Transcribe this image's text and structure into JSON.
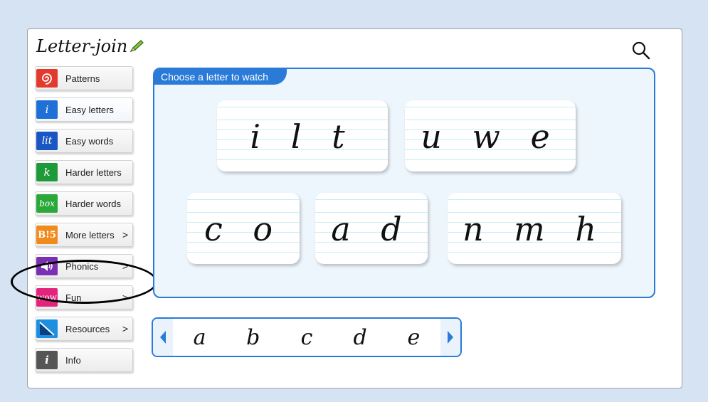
{
  "app": {
    "logo_text": "Letter-join"
  },
  "sidebar": {
    "items": [
      {
        "label": "Patterns",
        "icon": "spiral-icon",
        "glyph": "",
        "color": "#e23b2e",
        "chevron": ""
      },
      {
        "label": "Easy letters",
        "icon": "letter-i-icon",
        "glyph": "i",
        "color": "#1e6fd6",
        "chevron": ""
      },
      {
        "label": "Easy words",
        "icon": "word-lit-icon",
        "glyph": "lit",
        "color": "#1a55c4",
        "chevron": ""
      },
      {
        "label": "Harder letters",
        "icon": "letter-k-icon",
        "glyph": "k",
        "color": "#1f9a3a",
        "chevron": ""
      },
      {
        "label": "Harder words",
        "icon": "word-box-icon",
        "glyph": "box",
        "color": "#2aa83a",
        "chevron": ""
      },
      {
        "label": "More letters",
        "icon": "b-exclaim-5-icon",
        "glyph": "B!5",
        "color": "#f08a1c",
        "chevron": ">"
      },
      {
        "label": "Phonics",
        "icon": "speaker-icon",
        "glyph": "",
        "color": "#7a2fb4",
        "chevron": ">"
      },
      {
        "label": "Fun",
        "icon": "wow-icon",
        "glyph": "wow",
        "color": "#e2247d",
        "chevron": ">"
      },
      {
        "label": "Resources",
        "icon": "resources-icon",
        "glyph": "",
        "color": "#1c8fe0",
        "chevron": ">"
      },
      {
        "label": "Info",
        "icon": "info-icon",
        "glyph": "i",
        "color": "#555555",
        "chevron": ""
      }
    ]
  },
  "panel": {
    "title": "Choose a letter to watch",
    "groups": [
      "i l t",
      "u w e",
      "c o",
      "a d",
      "n m h"
    ]
  },
  "strip": {
    "letters": [
      "a",
      "b",
      "c",
      "d",
      "e"
    ]
  }
}
